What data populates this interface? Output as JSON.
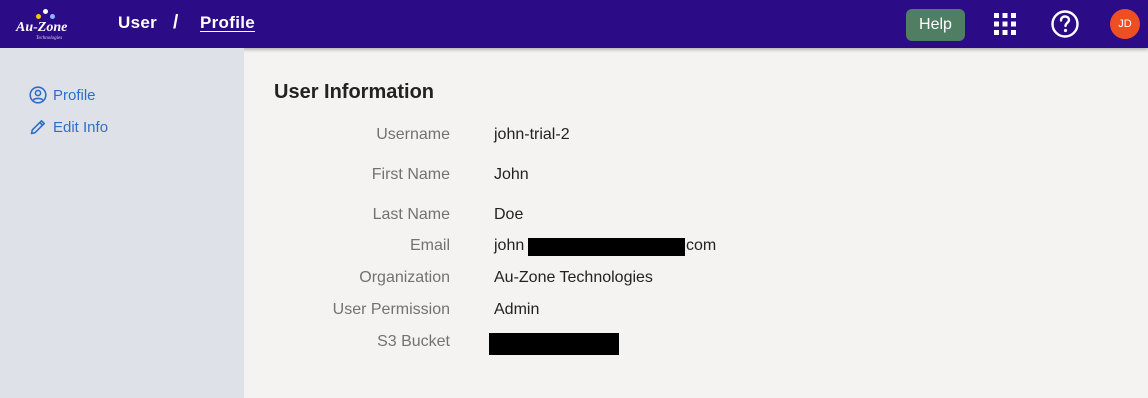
{
  "header": {
    "logo_text": "Au-Zone",
    "logo_sub": "Technologies",
    "breadcrumb": [
      "User",
      "/",
      "Profile"
    ],
    "help_label": "Help",
    "apps_icon": "grid-apps-icon",
    "help_icon": "question-circle-icon",
    "avatar_initials": "JD",
    "colors": {
      "bar": "#2c0b86",
      "help": "#4f7e63",
      "avatar": "#ee4f22"
    }
  },
  "sidebar": {
    "items": [
      {
        "label": "Profile",
        "icon": "user-circle-icon"
      },
      {
        "label": "Edit Info",
        "icon": "pencil-icon"
      }
    ],
    "link_color": "#2f6ec8"
  },
  "main": {
    "title": "User Information",
    "fields": [
      {
        "label": "Username",
        "value": "john-trial-2"
      },
      {
        "label": "First Name",
        "value": "John"
      },
      {
        "label": "Last Name",
        "value": "Doe"
      },
      {
        "label": "Email",
        "value_prefix": "john",
        "value_suffix": "com"
      },
      {
        "label": "Organization",
        "value": "Au-Zone Technologies"
      },
      {
        "label": "User Permission",
        "value": "Admin"
      },
      {
        "label": "S3 Bucket",
        "value": ""
      }
    ]
  }
}
